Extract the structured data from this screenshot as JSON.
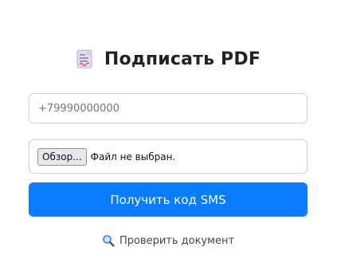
{
  "header": {
    "title": "Подписать PDF",
    "icon": "document-signature-icon"
  },
  "phone": {
    "placeholder": "+79990000000",
    "value": ""
  },
  "file": {
    "button_label": "Обзор...",
    "status": "Файл не выбран."
  },
  "actions": {
    "sms_label": "Получить код SMS",
    "verify_label": "Проверить документ",
    "verify_icon": "magnifier-icon"
  },
  "colors": {
    "primary": "#0a7cff",
    "border": "#cfcfcf",
    "text": "#222222"
  }
}
